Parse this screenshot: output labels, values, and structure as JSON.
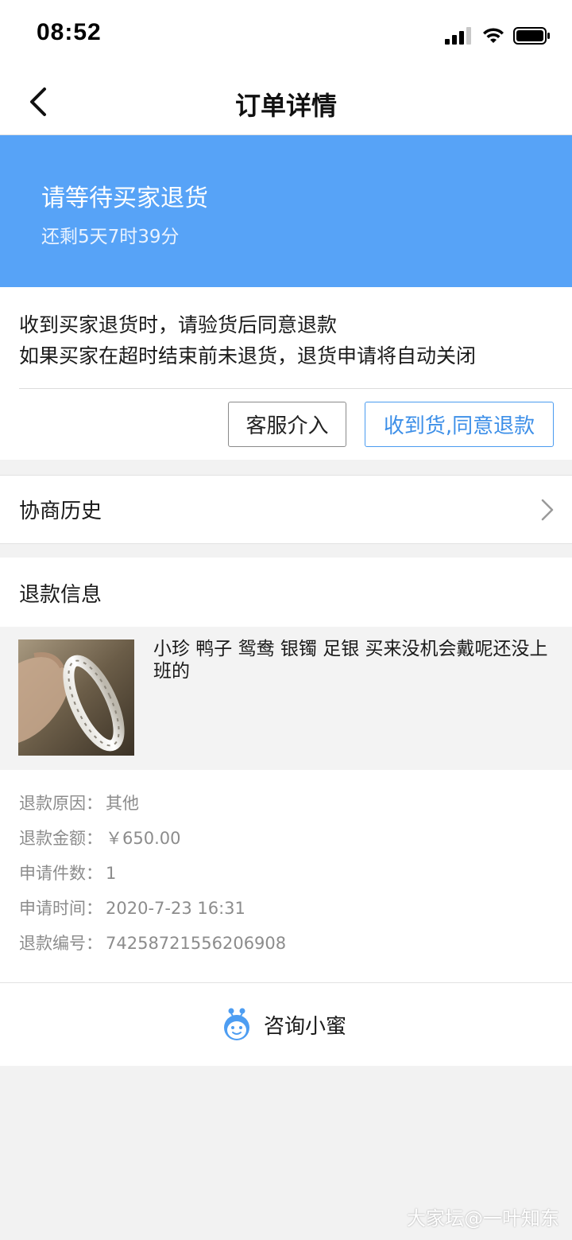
{
  "status_bar": {
    "time": "08:52"
  },
  "nav": {
    "title": "订单详情"
  },
  "banner": {
    "title": "请等待买家退货",
    "countdown": "还剩5天7时39分"
  },
  "notice": {
    "line1": "收到买家退货时，请验货后同意退款",
    "line2": "如果买家在超时结束前未退货，退货申请将自动关闭",
    "service_button": "客服介入",
    "agree_button": "收到货,同意退款"
  },
  "history": {
    "label": "协商历史"
  },
  "refund": {
    "section_title": "退款信息",
    "product_title": "小珍 鸭子 鸳鸯 银镯 足银 买来没机会戴呢还没上班的",
    "rows": [
      {
        "label": "退款原因：",
        "value": "其他"
      },
      {
        "label": "退款金额：",
        "value": "￥650.00"
      },
      {
        "label": "申请件数：",
        "value": "1"
      },
      {
        "label": "申请时间：",
        "value": "2020-7-23 16:31"
      },
      {
        "label": "退款编号：",
        "value": "74258721556206908"
      }
    ]
  },
  "consult": {
    "label": "咨询小蜜",
    "icon": "assistant-face-icon"
  },
  "watermark": "大家坛@一叶知东",
  "colors": {
    "accent_blue": "#57a3f7",
    "button_blue": "#3d8fe8"
  }
}
